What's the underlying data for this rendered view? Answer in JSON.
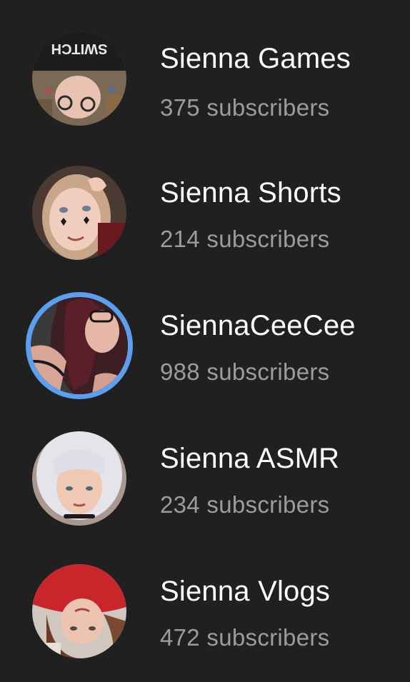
{
  "accounts": [
    {
      "name": "Sienna Games",
      "subscribers": "375 subscribers",
      "avatar": "avatar-games-photo",
      "selected": false
    },
    {
      "name": "Sienna Shorts",
      "subscribers": "214 subscribers",
      "avatar": "avatar-shorts-photo",
      "selected": false
    },
    {
      "name": "SiennaCeeCee",
      "subscribers": "988 subscribers",
      "avatar": "avatar-ceecee-photo",
      "selected": true
    },
    {
      "name": "Sienna ASMR",
      "subscribers": "234 subscribers",
      "avatar": "avatar-asmr-photo",
      "selected": false
    },
    {
      "name": "Sienna Vlogs",
      "subscribers": "472 subscribers",
      "avatar": "avatar-vlogs-photo",
      "selected": false
    }
  ],
  "colors": {
    "background": "#202020",
    "name_text": "#ffffff",
    "subscriber_text": "#9c9c9c",
    "selected_ring": "#5aa0ef"
  },
  "avatar_text": {
    "shirt_print": "SWITCH"
  }
}
